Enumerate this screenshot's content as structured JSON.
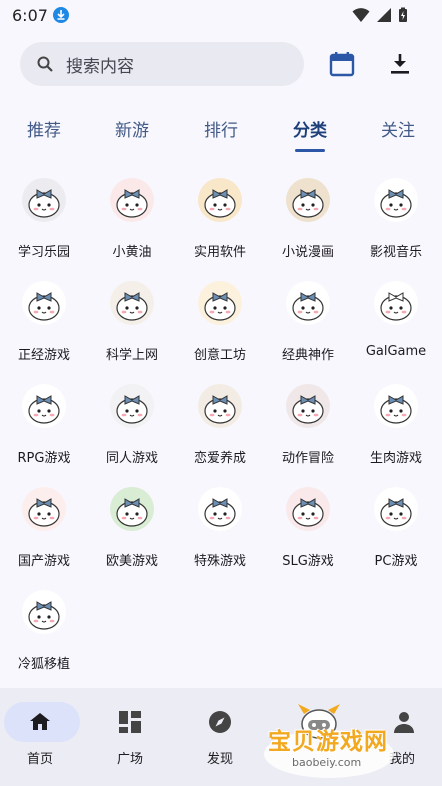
{
  "status": {
    "time": "6:07"
  },
  "search": {
    "placeholder": "搜索内容"
  },
  "tabs": [
    {
      "label": "推荐",
      "active": false
    },
    {
      "label": "新游",
      "active": false
    },
    {
      "label": "排行",
      "active": false
    },
    {
      "label": "分类",
      "active": true
    },
    {
      "label": "关注",
      "active": false
    }
  ],
  "categories": [
    {
      "label": "学习乐园",
      "bg": "#ececf0",
      "bow": "#6b8fb5"
    },
    {
      "label": "小黄油",
      "bg": "#fbe9ea",
      "bow": "#6b8fb5"
    },
    {
      "label": "实用软件",
      "bg": "#f8e7c8",
      "bow": "#6b8fb5"
    },
    {
      "label": "小说漫画",
      "bg": "#eee1cd",
      "bow": "#6b8fb5"
    },
    {
      "label": "影视音乐",
      "bg": "#ffffff",
      "bow": "#6b8fb5"
    },
    {
      "label": "正经游戏",
      "bg": "#ffffff",
      "bow": "#6b8fb5"
    },
    {
      "label": "科学上网",
      "bg": "#f4efe8",
      "bow": "#6b8fb5"
    },
    {
      "label": "创意工坊",
      "bg": "#fbf1dc",
      "bow": "#6b8fb5"
    },
    {
      "label": "经典神作",
      "bg": "#ffffff",
      "bow": "#6b8fb5"
    },
    {
      "label": "GalGame",
      "bg": "#ffffff",
      "bow": "#ffffff"
    },
    {
      "label": "RPG游戏",
      "bg": "#ffffff",
      "bow": "#6b8fb5"
    },
    {
      "label": "同人游戏",
      "bg": "#f2f2f4",
      "bow": "#6b8fb5"
    },
    {
      "label": "恋爱养成",
      "bg": "#f3ece4",
      "bow": "#6b8fb5"
    },
    {
      "label": "动作冒险",
      "bg": "#f0e8e8",
      "bow": "#6b8fb5"
    },
    {
      "label": "生肉游戏",
      "bg": "#ffffff",
      "bow": "#6b8fb5"
    },
    {
      "label": "国产游戏",
      "bg": "#fdeeee",
      "bow": "#6b8fb5"
    },
    {
      "label": "欧美游戏",
      "bg": "#d9ecd4",
      "bow": "#6b8fb5"
    },
    {
      "label": "特殊游戏",
      "bg": "#ffffff",
      "bow": "#6b8fb5"
    },
    {
      "label": "SLG游戏",
      "bg": "#fae9ea",
      "bow": "#6b8fb5"
    },
    {
      "label": "PC游戏",
      "bg": "#ffffff",
      "bow": "#6b8fb5"
    },
    {
      "label": "冷狐移植",
      "bg": "#ffffff",
      "bow": "#6b8fb5"
    }
  ],
  "bottom_nav": [
    {
      "label": "首页",
      "icon": "home-icon",
      "active": true
    },
    {
      "label": "广场",
      "icon": "grid-icon",
      "active": false
    },
    {
      "label": "发现",
      "icon": "compass-icon",
      "active": false
    },
    {
      "label": "",
      "icon": "",
      "active": false
    },
    {
      "label": "我的",
      "icon": "person-icon",
      "active": false
    }
  ],
  "watermark": {
    "text": "宝贝游戏网",
    "url": "baobeiy.com"
  },
  "colors": {
    "accent": "#2b57a6",
    "nav_pill": "#dce2f9",
    "tab_text": "#425a87"
  }
}
